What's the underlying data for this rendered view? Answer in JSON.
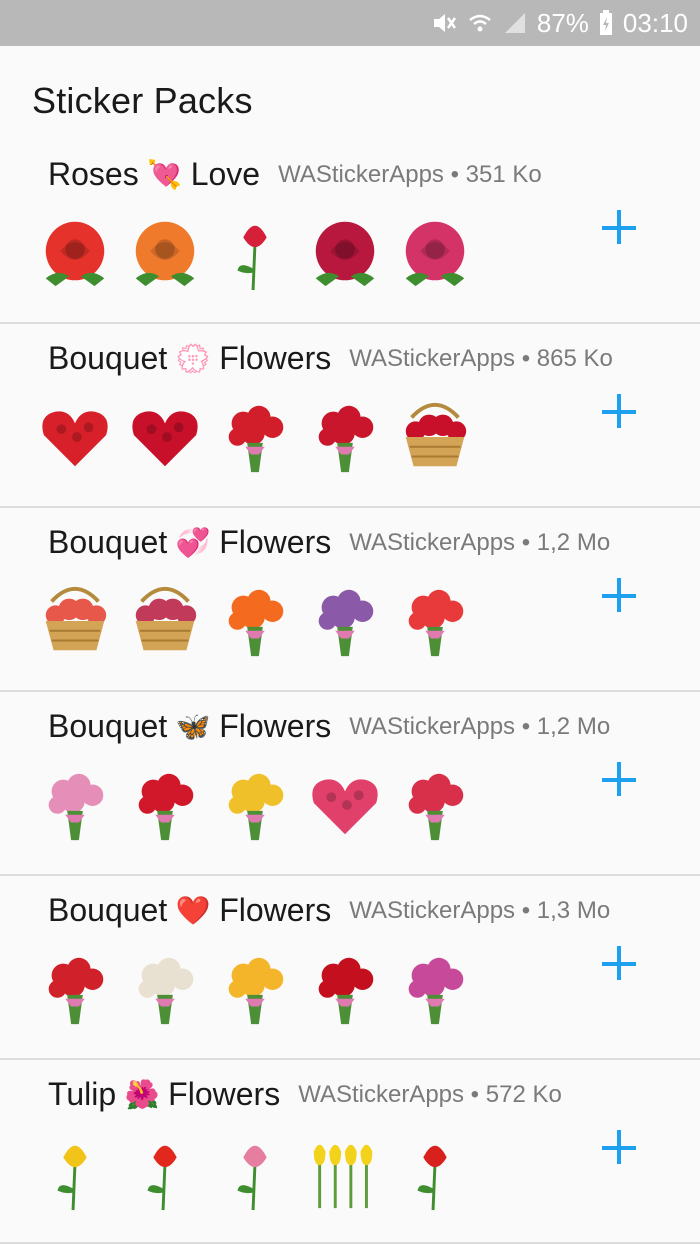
{
  "status_bar": {
    "battery": "87%",
    "time": "03:10",
    "icons": [
      "mute-icon",
      "wifi-icon",
      "signal-icon",
      "battery-charging-icon"
    ]
  },
  "page": {
    "title": "Sticker Packs"
  },
  "packs": [
    {
      "name_left": "Roses",
      "emoji": "💘",
      "name_right": "Love",
      "meta": "WAStickerApps • 351 Ko",
      "stickers": [
        "red-rose",
        "orange-rose",
        "single-rose-stem",
        "crimson-rose",
        "pink-rose"
      ]
    },
    {
      "name_left": "Bouquet",
      "emoji": "💮",
      "name_right": "Flowers",
      "meta": "WAStickerApps • 865 Ko",
      "stickers": [
        "heart-of-roses",
        "rose-heart",
        "rose-bouquet",
        "roses-in-vase",
        "rose-basket"
      ]
    },
    {
      "name_left": "Bouquet",
      "emoji": "💞",
      "name_right": "Flowers",
      "meta": "WAStickerApps • 1,2 Mo",
      "stickers": [
        "flower-basket",
        "flower-basket-2",
        "gerbera-bouquet",
        "lilac-vase",
        "mixed-bouquet"
      ]
    },
    {
      "name_left": "Bouquet",
      "emoji": "🦋",
      "name_right": "Flowers",
      "meta": "WAStickerApps • 1,2 Mo",
      "stickers": [
        "pink-rose-bouquet",
        "red-rose-bouquet",
        "yellow-rose-bouquet",
        "pink-flower-heart",
        "wrapped-bouquet"
      ]
    },
    {
      "name_left": "Bouquet",
      "emoji": "❤️",
      "name_right": "Flowers",
      "meta": "WAStickerApps • 1,3 Mo",
      "stickers": [
        "red-bouquet",
        "white-red-bouquet",
        "yellow-bouquet",
        "big-red-bouquet",
        "mixed-bouquet-2"
      ]
    },
    {
      "name_left": "Tulip",
      "emoji": "🌺",
      "name_right": "Flowers",
      "meta": "WAStickerApps • 572 Ko",
      "stickers": [
        "yellow-tulip",
        "red-tulip-head",
        "pink-tulip",
        "yellow-tulips",
        "red-tulip"
      ]
    }
  ]
}
